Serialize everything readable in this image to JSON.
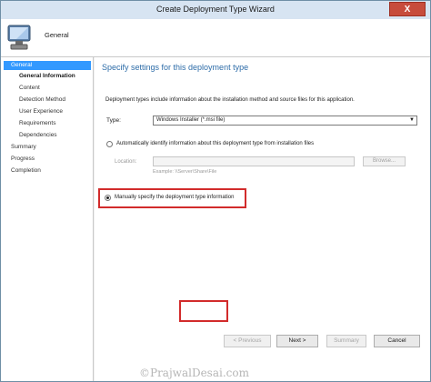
{
  "window": {
    "title": "Create Deployment Type Wizard",
    "close_label": "X"
  },
  "header": {
    "title": "General",
    "icon": "computer-icon"
  },
  "nav": {
    "items": [
      {
        "label": "General",
        "state": "active"
      },
      {
        "label": "General Information",
        "state": "current"
      },
      {
        "label": "Content"
      },
      {
        "label": "Detection Method"
      },
      {
        "label": "User Experience"
      },
      {
        "label": "Requirements"
      },
      {
        "label": "Dependencies"
      },
      {
        "label": "Summary"
      },
      {
        "label": "Progress"
      },
      {
        "label": "Completion"
      }
    ]
  },
  "main": {
    "heading": "Specify settings for this deployment type",
    "description": "Deployment types include information about the installation method and source files for this application.",
    "type_label": "Type:",
    "type_value": "Windows Installer (*.msi file)",
    "auto_option": "Automatically identify information about this deployment type from installation files",
    "location_label": "Location:",
    "location_value": "",
    "browse_label": "Browse...",
    "example": "Example: \\\\Server\\Share\\File",
    "manual_option": "Manually specify the deployment type information",
    "selected_option": "manual"
  },
  "footer": {
    "previous": "< Previous",
    "next": "Next >",
    "summary": "Summary",
    "cancel": "Cancel"
  },
  "watermark": "©PrajwalDesai.com",
  "colors": {
    "accent": "#3399ff",
    "heading": "#2d6ca8",
    "highlight": "#d22b2b"
  }
}
